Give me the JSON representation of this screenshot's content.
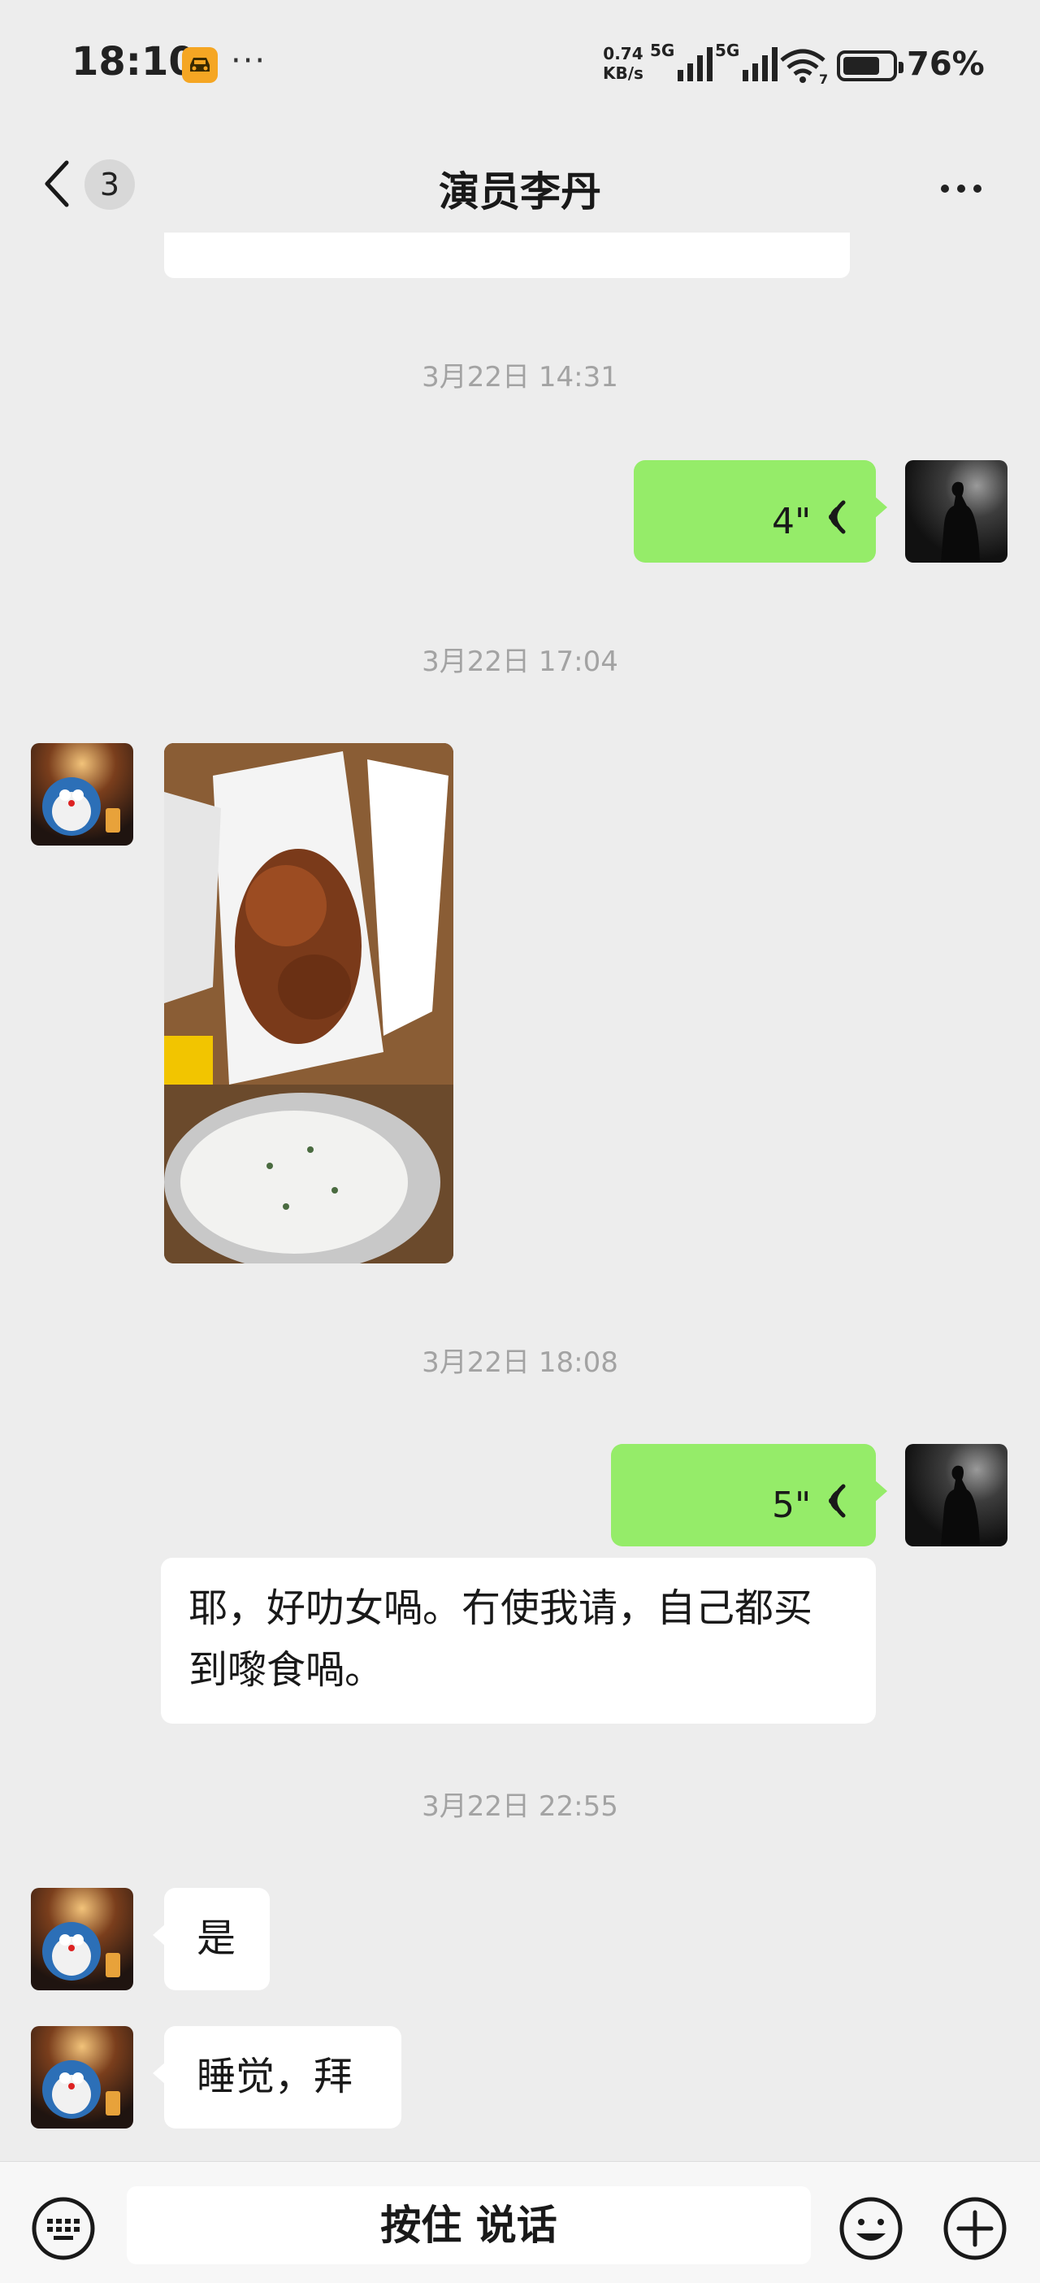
{
  "status_bar": {
    "time": "18:10",
    "dots": "···",
    "net_speed_value": "0.74",
    "net_speed_unit": "KB/s",
    "sim1_label": "5G",
    "sim2_label": "5G",
    "wifi_badge": "7",
    "battery": "76%",
    "battery_level_pct": 76,
    "car_icon_color": "#f5a623"
  },
  "nav": {
    "unread_count": "3",
    "title": "演员李丹"
  },
  "messages": {
    "ts1": "3月22日 14:31",
    "voice1_duration": "4\"",
    "ts2": "3月22日 17:04",
    "ts3": "3月22日 18:08",
    "voice2_duration": "5\"",
    "text1": "耶，好叻女喎。冇使我请，自己都买到嚟食喎。",
    "ts4": "3月22日 22:55",
    "text2": "是",
    "text3": "睡觉，拜"
  },
  "input_bar": {
    "hold_to_talk": "按住 说话"
  },
  "colors": {
    "background": "#ededed",
    "self_bubble": "#95ec69",
    "other_bubble": "#ffffff",
    "timestamp": "#a3a3a3"
  }
}
